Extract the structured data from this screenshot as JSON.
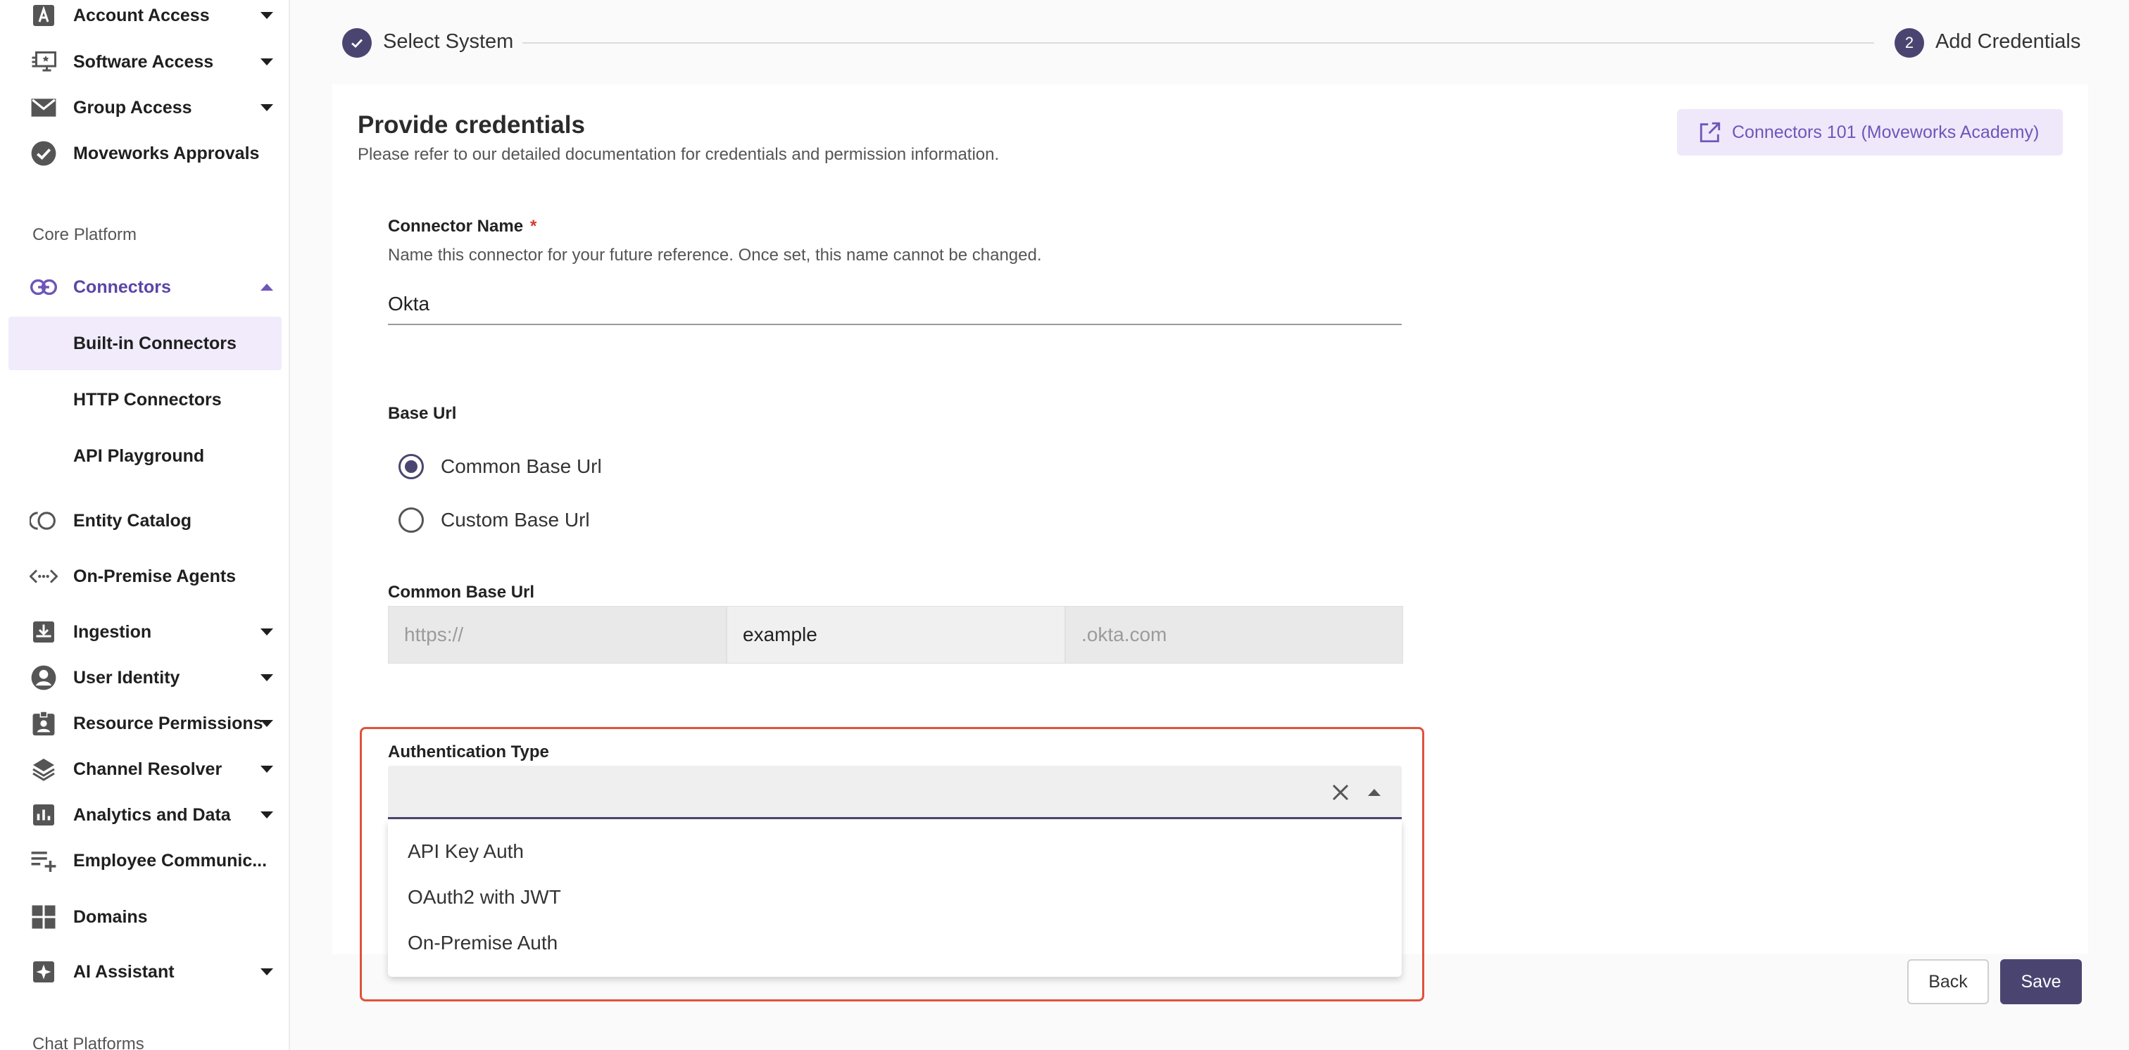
{
  "sidebar": {
    "items_top": [
      {
        "label": "Account Access",
        "icon": "account-access-icon"
      },
      {
        "label": "Software Access",
        "icon": "software-access-icon"
      },
      {
        "label": "Group Access",
        "icon": "group-access-icon"
      },
      {
        "label": "Moveworks Approvals",
        "icon": "check-circle-icon"
      }
    ],
    "section_core": "Core Platform",
    "connectors_label": "Connectors",
    "connectors_sub": [
      "Built-in Connectors",
      "HTTP Connectors",
      "API Playground"
    ],
    "items_bottom": [
      {
        "label": "Entity Catalog"
      },
      {
        "label": "On-Premise Agents"
      },
      {
        "label": "Ingestion"
      },
      {
        "label": "User Identity"
      },
      {
        "label": "Resource Permissions"
      },
      {
        "label": "Channel Resolver"
      },
      {
        "label": "Analytics and Data"
      },
      {
        "label": "Employee Communic..."
      },
      {
        "label": "Domains"
      },
      {
        "label": "AI Assistant"
      }
    ],
    "section_chat": "Chat Platforms"
  },
  "stepper": {
    "step1_label": "Select System",
    "step2_number": "2",
    "step2_label": "Add Credentials"
  },
  "form": {
    "title": "Provide credentials",
    "subtitle": "Please refer to our detailed documentation for credentials and permission information.",
    "academy_button": "Connectors 101 (Moveworks Academy)",
    "connector_name_label": "Connector Name",
    "required_mark": "*",
    "connector_name_helper": "Name this connector for your future reference. Once set, this name cannot be changed.",
    "connector_name_value": "Okta",
    "base_url_label": "Base Url",
    "radio_common": "Common Base Url",
    "radio_custom": "Custom Base Url",
    "common_base_url_label": "Common Base Url",
    "url_prefix": "https://",
    "url_middle": "example",
    "url_suffix": ".okta.com",
    "auth_type_label": "Authentication Type",
    "auth_options": [
      "API Key Auth",
      "OAuth2 with JWT",
      "On-Premise Auth"
    ]
  },
  "footer": {
    "back": "Back",
    "save": "Save"
  },
  "colors": {
    "accent": "#4a4570",
    "brand_purple": "#6e56b8",
    "highlight": "#e0523a"
  }
}
